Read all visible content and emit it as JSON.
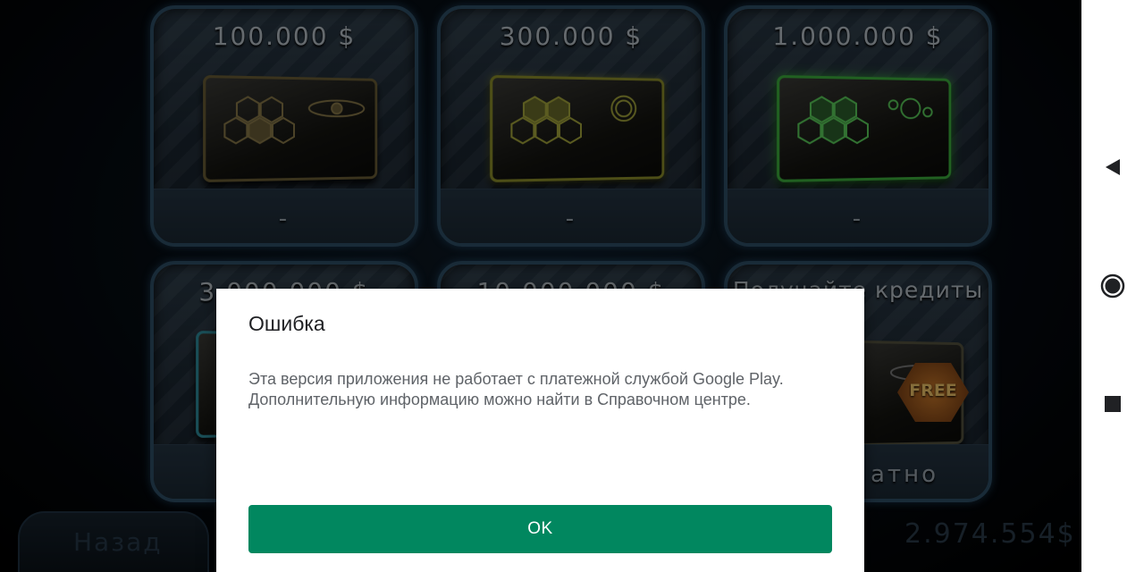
{
  "game": {
    "cards": [
      {
        "title": "100.000 $",
        "price": "-"
      },
      {
        "title": "300.000 $",
        "price": "-"
      },
      {
        "title": "1.000.000 $",
        "price": "-"
      },
      {
        "title": "3.000.000 $",
        "price": ""
      },
      {
        "title": "10.000.000 $",
        "price": ""
      },
      {
        "title": "Получайте кредиты",
        "price": "атно",
        "badge": "FREE"
      }
    ],
    "back_label": "Назад",
    "balance": "2.974.554$"
  },
  "dialog": {
    "title": "Ошибка",
    "message_line1": "Эта версия приложения не работает с платежной службой Google Play.",
    "message_line2": "Дополнительную информацию можно найти в Справочном центре.",
    "ok_label": "OK"
  },
  "navbar": {
    "icons": [
      "back-triangle-icon",
      "home-circle-icon",
      "recents-square-icon"
    ]
  },
  "colors": {
    "ok_button": "#01875f",
    "card_border": "#2f4f66",
    "dialog_bg": "#ffffff"
  }
}
